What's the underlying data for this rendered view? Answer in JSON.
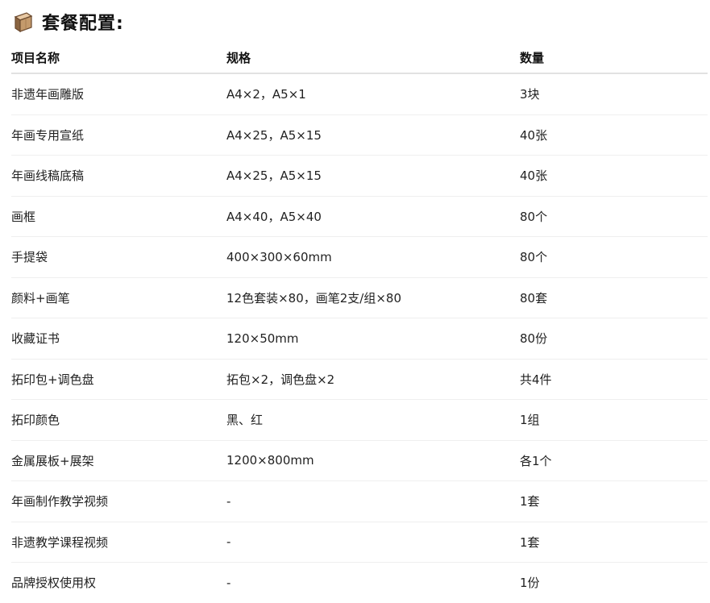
{
  "section": {
    "title": "套餐配置:"
  },
  "table": {
    "headers": [
      "项目名称",
      "规格",
      "数量"
    ],
    "rows": [
      [
        "非遗年画雕版",
        "A4×2，A5×1",
        "3块"
      ],
      [
        "年画专用宣纸",
        "A4×25，A5×15",
        "40张"
      ],
      [
        "年画线稿底稿",
        "A4×25，A5×15",
        "40张"
      ],
      [
        "画框",
        "A4×40，A5×40",
        "80个"
      ],
      [
        "手提袋",
        "400×300×60mm",
        "80个"
      ],
      [
        "颜料+画笔",
        "12色套装×80，画笔2支/组×80",
        "80套"
      ],
      [
        "收藏证书",
        "120×50mm",
        "80份"
      ],
      [
        "拓印包+调色盘",
        "拓包×2，调色盘×2",
        "共4件"
      ],
      [
        "拓印颜色",
        "黑、红",
        "1组"
      ],
      [
        "金属展板+展架",
        "1200×800mm",
        "各1个"
      ],
      [
        "年画制作教学视频",
        "-",
        "1套"
      ],
      [
        "非遗教学课程视频",
        "-",
        "1套"
      ],
      [
        "品牌授权使用权",
        "-",
        "1份"
      ]
    ]
  },
  "icons": {
    "title_icon": "package-box-icon"
  }
}
